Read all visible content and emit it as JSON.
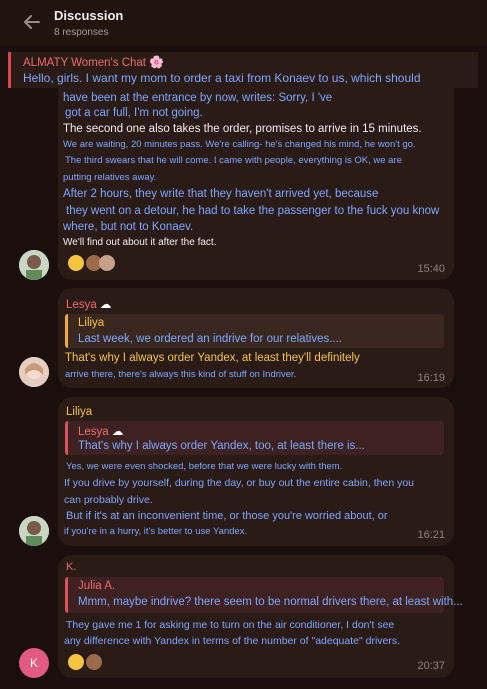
{
  "header": {
    "title": "Discussion",
    "subtitle": "8 responses"
  },
  "pinned": {
    "name": "ALMATY Women's Chat",
    "text": "Hello, girls. I want my mom to order a taxi from Konaev to us, which should"
  },
  "messages": [
    {
      "lines": [
        "have been at the entrance by now, writes: Sorry, I 've",
        "got a car full, I'm not going.",
        "The second one also takes the order, promises to arrive in 15 minutes.",
        "We are waiting, 20 minutes pass. We're calling- he's changed his mind, he won't go.",
        "The third swears that he will come. I came with people, everything is OK, we are",
        "putting relatives away.",
        "After 2 hours, they write that they haven't arrived yet, because",
        "they went on a detour, he had to take the passenger to the fuck you know",
        "where, but not to Konaev.",
        "We'll find out about it after the fact."
      ],
      "time": "15:40"
    },
    {
      "sender": "Lesya",
      "quote_name": "Liliya",
      "quote_text": "Last week, we ordered an indrive for our relatives....",
      "lines": [
        "That's why I always order Yandex, at least they'll definitely",
        "arrive there, there's always this kind of stuff on Indriver."
      ],
      "time": "16:19"
    },
    {
      "sender": "Liliya",
      "quote_name": "Lesya",
      "quote_text": "That's why I always order Yandex, too, at least there is...",
      "lines": [
        "Yes, we were even shocked, before that we were lucky with them.",
        "If you drive by yourself, during the day, or buy out the entire cabin, then you",
        "can probably drive.",
        "But if it's at an inconvenient time, or those you're worried about, or",
        "if you're in a hurry, it's better to use Yandex."
      ],
      "time": "16:21"
    },
    {
      "sender": "K.",
      "avatar_letter": "K",
      "quote_name": "Julia A.",
      "quote_text": "Mmm, maybe indrive? there seem to be normal drivers there, at least with...",
      "lines": [
        "They gave me 1 for asking me to turn on the air conditioner, I don't see",
        "any difference with Yandex in terms of the number of \"adequate\" drivers."
      ],
      "time": "20:37"
    }
  ],
  "colors": {
    "background": "#1a0f0d",
    "bubble": "#2a1b17",
    "blue_text": "#7da8ff",
    "red_name": "#ef6b6b",
    "yellow": "#f5c542",
    "avatar_k": "#e05a84"
  },
  "icons": [
    "back-arrow-icon",
    "cherry-blossom-icon",
    "cloud-icon",
    "neutral-face-icon",
    "grinning-face-icon"
  ]
}
